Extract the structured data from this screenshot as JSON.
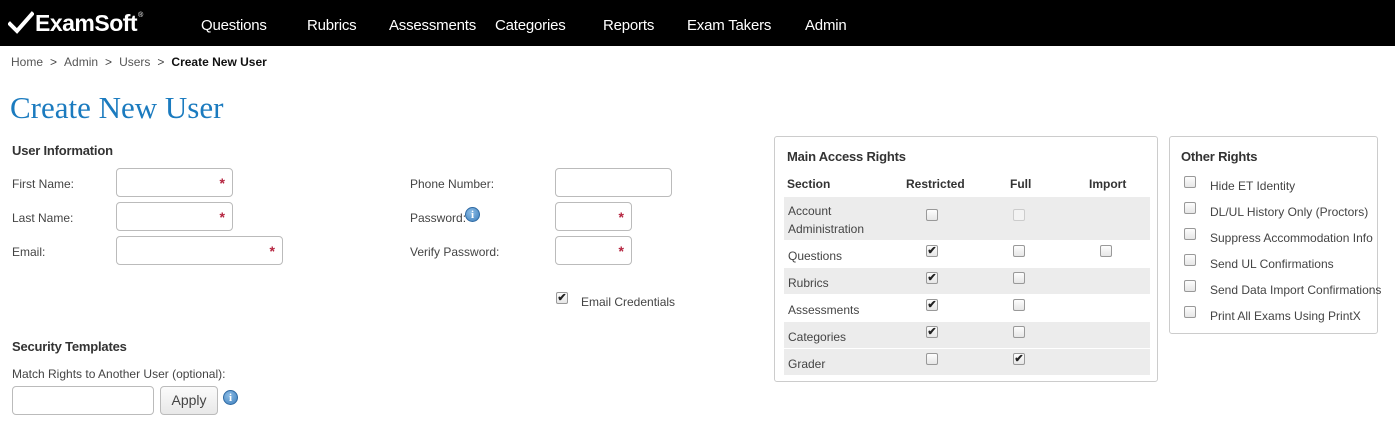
{
  "brand": {
    "name": "ExamSoft",
    "trademark": "®"
  },
  "nav": {
    "items": [
      {
        "label": "Questions"
      },
      {
        "label": "Rubrics"
      },
      {
        "label": "Assessments"
      },
      {
        "label": "Categories"
      },
      {
        "label": "Reports"
      },
      {
        "label": "Exam Takers"
      },
      {
        "label": "Admin"
      }
    ]
  },
  "breadcrumb": {
    "items": [
      "Home",
      "Admin",
      "Users"
    ],
    "separator": ">",
    "current": "Create New User"
  },
  "page": {
    "title": "Create New User"
  },
  "user_info": {
    "heading": "User Information",
    "first_name": {
      "label": "First Name:",
      "value": "",
      "required": true
    },
    "last_name": {
      "label": "Last Name:",
      "value": "",
      "required": true
    },
    "email": {
      "label": "Email:",
      "value": "",
      "required": true
    },
    "phone": {
      "label": "Phone Number:",
      "value": ""
    },
    "password": {
      "label": "Password:",
      "value": "",
      "required": true
    },
    "verify_password": {
      "label": "Verify Password:",
      "value": "",
      "required": true
    },
    "email_credentials": {
      "label": "Email Credentials",
      "checked": true
    },
    "required_marker": "*",
    "info_glyph": "i"
  },
  "security_templates": {
    "heading": "Security Templates",
    "match_label": "Match Rights to Another User (optional):",
    "match_value": "",
    "apply_label": "Apply"
  },
  "main_access": {
    "heading": "Main Access Rights",
    "columns": [
      "Section",
      "Restricted",
      "Full",
      "Import"
    ],
    "rows": [
      {
        "section": "Account Administration",
        "section_line1": "Account",
        "section_line2": "Administration",
        "restricted": false,
        "full": false,
        "full_disabled": true,
        "import": null
      },
      {
        "section": "Questions",
        "restricted": true,
        "full": false,
        "import": false
      },
      {
        "section": "Rubrics",
        "restricted": true,
        "full": false,
        "import": null
      },
      {
        "section": "Assessments",
        "restricted": true,
        "full": false,
        "import": null
      },
      {
        "section": "Categories",
        "restricted": true,
        "full": false,
        "import": null
      },
      {
        "section": "Grader",
        "restricted": false,
        "full": true,
        "import": null
      }
    ]
  },
  "other_rights": {
    "heading": "Other Rights",
    "items": [
      {
        "label": "Hide ET Identity",
        "checked": false
      },
      {
        "label": "DL/UL History Only (Proctors)",
        "checked": false
      },
      {
        "label": "Suppress Accommodation Info",
        "checked": false
      },
      {
        "label": "Send UL Confirmations",
        "checked": false
      },
      {
        "label": "Send Data Import Confirmations",
        "checked": false
      },
      {
        "label": "Print All Exams Using PrintX",
        "checked": false
      }
    ]
  },
  "check_glyph": "✔",
  "colors": {
    "title": "#1b7bbf",
    "required": "#b5243f",
    "nav_bg": "#000000"
  }
}
